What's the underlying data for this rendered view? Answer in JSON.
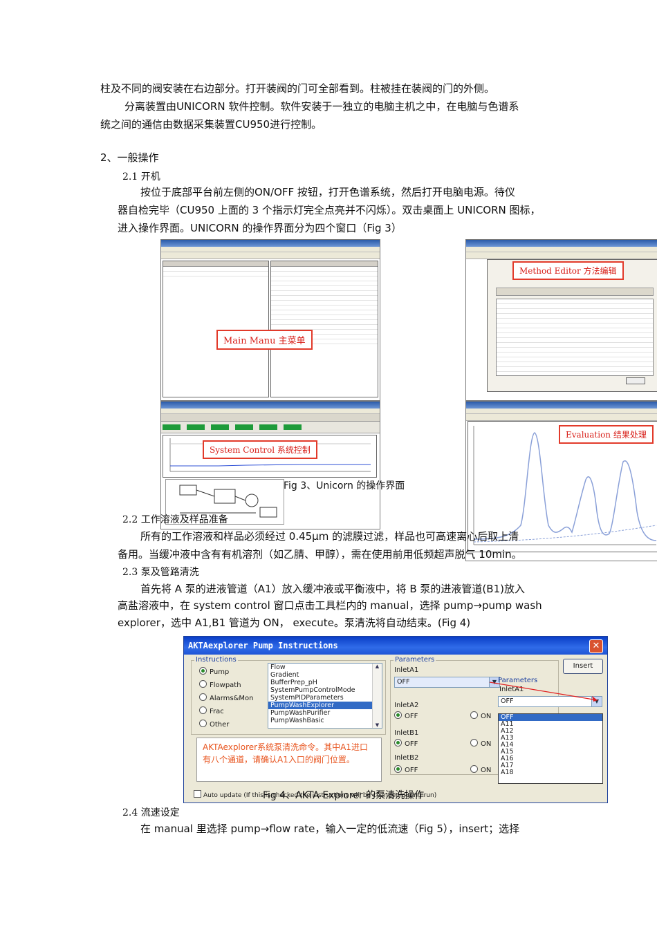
{
  "paragraphs": {
    "p1": "柱及不同的阀安装在右边部分。打开装阀的门可全部看到。柱被挂在装阀的门的外侧。",
    "p2a": "分离装置由UNICORN  软件控制。软件安装于一独立的电脑主机之中，在电脑与色谱系",
    "p2b": "统之间的通信由数据采集装置CU950进行控制。",
    "sec2": "2、一般操作",
    "sec21": "2.1  开机",
    "p3a": "按位于底部平台前左侧的ON/OFF  按钮，打开色谱系统，然后打开电脑电源。待仪",
    "p3b": "器自检完毕（CU950 上面的 3 个指示灯完全点亮并不闪烁）。双击桌面上 UNICORN 图标，",
    "p3c": "进入操作界面。UNICORN 的操作界面分为四个窗口（Fig 3）",
    "sec22": "2.2  工作溶液及样品准备",
    "p4a": "所有的工作溶液和样品必须经过  0.45μm  的滤膜过滤，样品也可高速离心后取上清",
    "p4b": "备用。当缓冲液中含有有机溶剂（如乙腈、甲醇），需在使用前用低频超声脱气 10min。",
    "sec23": "2.3  泵及管路清洗",
    "p5a": "首先将 A 泵的进液管道（A1）放入缓冲液或平衡液中，将 B 泵的进液管道(B1)放入",
    "p5b": "高盐溶液中，在  system  control  窗口点击工具栏内的  manual，选择  pump→pump  wash",
    "p5c": "explorer，选中 A1,B1 管道为 ON，   execute。泵清洗将自动结束。(Fig 4)",
    "sec24": "2.4 流速设定",
    "p6": "在   manual   里选择   pump→flow   rate，输入一定的低流速（Fig   5），insert；选择"
  },
  "fig3": {
    "label_main": "Main Manu 主菜单",
    "label_method": "Method Editor 方法编辑",
    "label_system": "System Control 系统控制",
    "label_eval": "Evaluation 结果处理",
    "caption": "Fig 3、Unicorn 的操作界面"
  },
  "fig4": {
    "dialog_title": "AKTAexplorer Pump Instructions",
    "instructions_label": "Instructions",
    "radios": [
      "Pump",
      "Flowpath",
      "Alarms&Mon",
      "Frac",
      "Other"
    ],
    "list_items": [
      "Flow",
      "Gradient",
      "BufferPrep_pH",
      "SystemPumpControlMode",
      "SystemPIDParameters",
      "PumpWashExplorer",
      "PumpWashPurifier",
      "PumpWashBasic"
    ],
    "selected_item": "PumpWashExplorer",
    "parameters_label": "Parameters",
    "inlet_a1": "InletA1",
    "inlet_a1_value": "OFF",
    "inlet_a2": "InletA2",
    "inlet_b1": "InletB1",
    "inlet_b2": "InletB2",
    "off": "OFF",
    "on": "ON",
    "insert": "Insert",
    "popup_parameters": "Parameters",
    "popup_inlet": "InletA1",
    "popup_value": "OFF",
    "dropdown_options": [
      "OFF",
      "A11",
      "A12",
      "A13",
      "A14",
      "A15",
      "A16",
      "A17",
      "A18"
    ],
    "note": "AKTAexplorer系统泵清洗命令。其中A1进口有八个通道，请确认A1入口的阀门位置。",
    "auto_update": "Auto update (If this is checked the instructions will be changed during run)",
    "caption": "Fig 4、AKTA Explorer 的泵清洗操作"
  }
}
